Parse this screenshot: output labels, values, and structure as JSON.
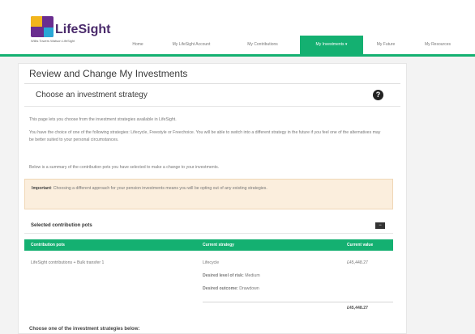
{
  "brand": {
    "name": "LifeSight",
    "tagline": "Willis Towers Watson LifeSight"
  },
  "nav": {
    "items": [
      {
        "label": "Home"
      },
      {
        "label": "My LifeSight Account"
      },
      {
        "label": "My Contributions"
      },
      {
        "label": "My Investments ▾"
      },
      {
        "label": "My Future"
      },
      {
        "label": "My Resources"
      }
    ]
  },
  "page": {
    "title": "Review and Change My Investments",
    "section_title": "Choose an investment strategy",
    "para1": "This page lets you choose from the investment strategies available in LifeSight.",
    "para2": "You have the choice of one of the following strategies: Lifecycle, Freestyle or Freechoice. You will be able to switch into a different strategy in the future if you feel one of the alternatives may be better suited to your personal circumstances.",
    "para3": "Below is a summary of the contribution pots you have selected to make a change to your investments.",
    "notice_bold": "Important",
    "notice_text": ": Choosing a different approach for your pension investments means you will be opting out of any existing strategies.",
    "subsection_title": "Selected contribution pots",
    "collapse_label": "−",
    "bottom_text": "Choose one of the investment strategies below:"
  },
  "table": {
    "headers": [
      "Contribution pots",
      "Current strategy",
      "Current value"
    ],
    "rows": [
      {
        "pot": "LifeSight contributions + Bulk transfer 1",
        "strategy": "Lifecycle",
        "risk_label": "Desired level of risk:",
        "risk_value": "Medium",
        "outcome_label": "Desired outcome:",
        "outcome_value": "Drawdown",
        "value": "£45,448.27"
      }
    ],
    "total": "£45,448.27"
  },
  "colors": {
    "accent_green": "#14b071",
    "notice_bg": "#fbeedd",
    "brand_purple": "#6a2d8f"
  }
}
